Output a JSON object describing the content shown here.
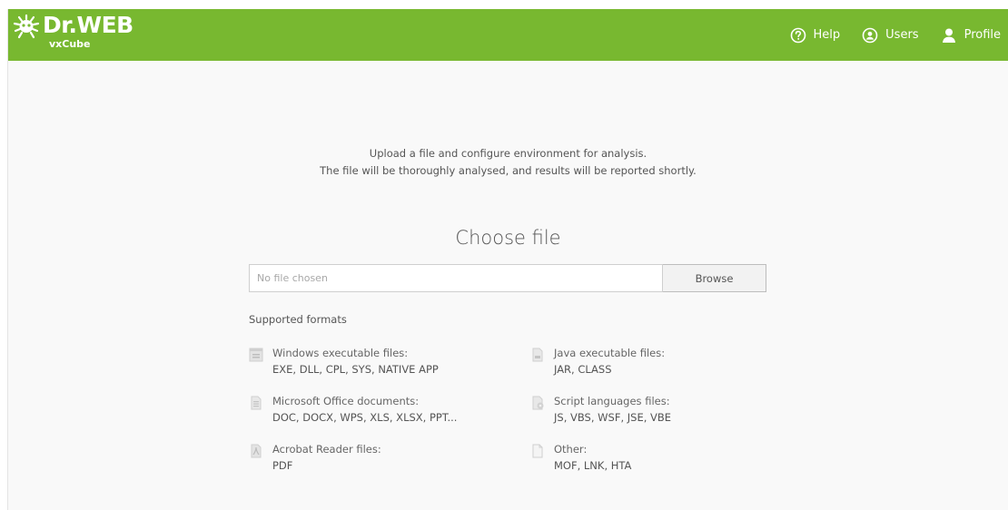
{
  "header": {
    "logo_text": "Dr.WEB",
    "logo_subtext": "vxCube",
    "nav": [
      {
        "label": "Help",
        "icon": "help-circle-icon"
      },
      {
        "label": "Users",
        "icon": "users-icon"
      },
      {
        "label": "Profile",
        "icon": "profile-icon"
      }
    ]
  },
  "intro": {
    "line1": "Upload a file and configure environment for analysis.",
    "line2": "The file will be thoroughly analysed, and results will be reported shortly."
  },
  "upload": {
    "title": "Choose file",
    "placeholder": "No file chosen",
    "browse_label": "Browse"
  },
  "supported_formats": {
    "label": "Supported formats",
    "items": [
      {
        "title": "Windows executable files:",
        "extensions": "EXE, DLL, CPL, SYS, NATIVE APP",
        "icon": "windows-file-icon"
      },
      {
        "title": "Microsoft Office documents:",
        "extensions": "DOC, DOCX, WPS, XLS, XLSX, PPT...",
        "icon": "office-document-icon"
      },
      {
        "title": "Acrobat Reader files:",
        "extensions": "PDF",
        "icon": "pdf-file-icon"
      },
      {
        "title": "Java executable files:",
        "extensions": "JAR, CLASS",
        "icon": "java-file-icon"
      },
      {
        "title": "Script languages files:",
        "extensions": "JS, VBS, WSF, JSE, VBE",
        "icon": "script-file-icon"
      },
      {
        "title": "Other:",
        "extensions": "MOF, LNK, HTA",
        "icon": "generic-file-icon"
      }
    ]
  },
  "colors": {
    "brand_green": "#78b830",
    "background": "#f9f9f9"
  }
}
